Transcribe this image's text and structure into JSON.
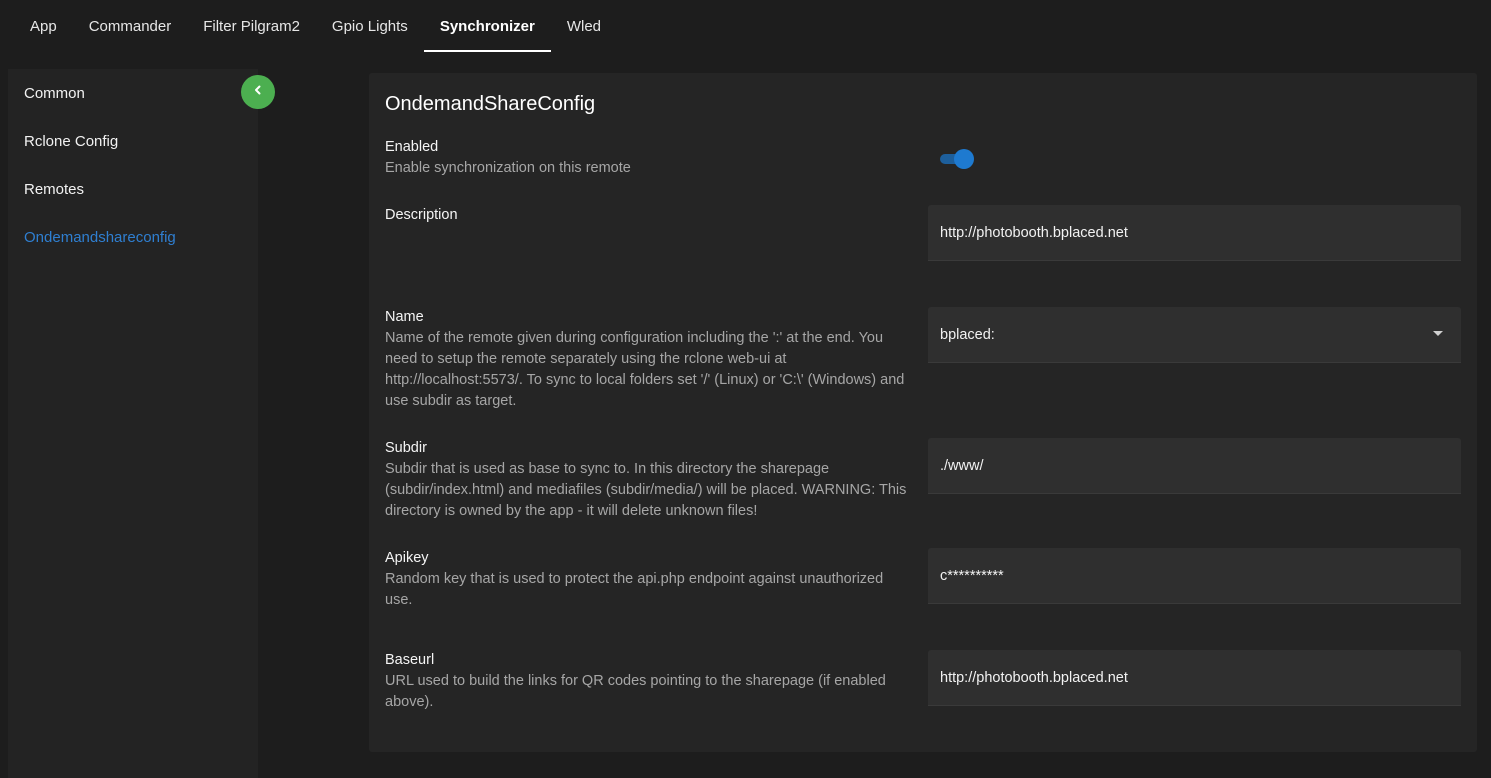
{
  "tabs": [
    {
      "label": "App"
    },
    {
      "label": "Commander"
    },
    {
      "label": "Filter Pilgram2"
    },
    {
      "label": "Gpio Lights"
    },
    {
      "label": "Synchronizer",
      "active": true
    },
    {
      "label": "Wled"
    }
  ],
  "sidebar": {
    "items": [
      {
        "label": "Common"
      },
      {
        "label": "Rclone Config"
      },
      {
        "label": "Remotes"
      },
      {
        "label": "Ondemandshareconfig",
        "active": true
      }
    ],
    "collapse_icon": "chevron-left-icon"
  },
  "card": {
    "title": "OndemandShareConfig",
    "enabled": {
      "label": "Enabled",
      "description": "Enable synchronization on this remote",
      "value": true
    },
    "description_field": {
      "label": "Description",
      "value": "http://photobooth.bplaced.net"
    },
    "name_field": {
      "label": "Name",
      "description": "Name of the remote given during configuration including the ':' at the end. You need to setup the remote separately using the rclone web-ui at http://localhost:5573/. To sync to local folders set '/' (Linux) or 'C:\\' (Windows) and use subdir as target.",
      "value": "bplaced:"
    },
    "subdir_field": {
      "label": "Subdir",
      "description": "Subdir that is used as base to sync to. In this directory the sharepage (subdir/index.html) and mediafiles (subdir/media/) will be placed. WARNING: This directory is owned by the app - it will delete unknown files!",
      "value": "./www/"
    },
    "apikey_field": {
      "label": "Apikey",
      "description": "Random key that is used to protect the api.php endpoint against unauthorized use.",
      "value": "c**********"
    },
    "baseurl_field": {
      "label": "Baseurl",
      "description": "URL used to build the links for QR codes pointing to the sharepage (if enabled above).",
      "value": "http://photobooth.bplaced.net"
    }
  },
  "colors": {
    "accent": "#1e7ad0",
    "fab": "#4caf50",
    "active_link": "#2f7fd1",
    "background": "#1d1d1d",
    "card": "#252525"
  }
}
